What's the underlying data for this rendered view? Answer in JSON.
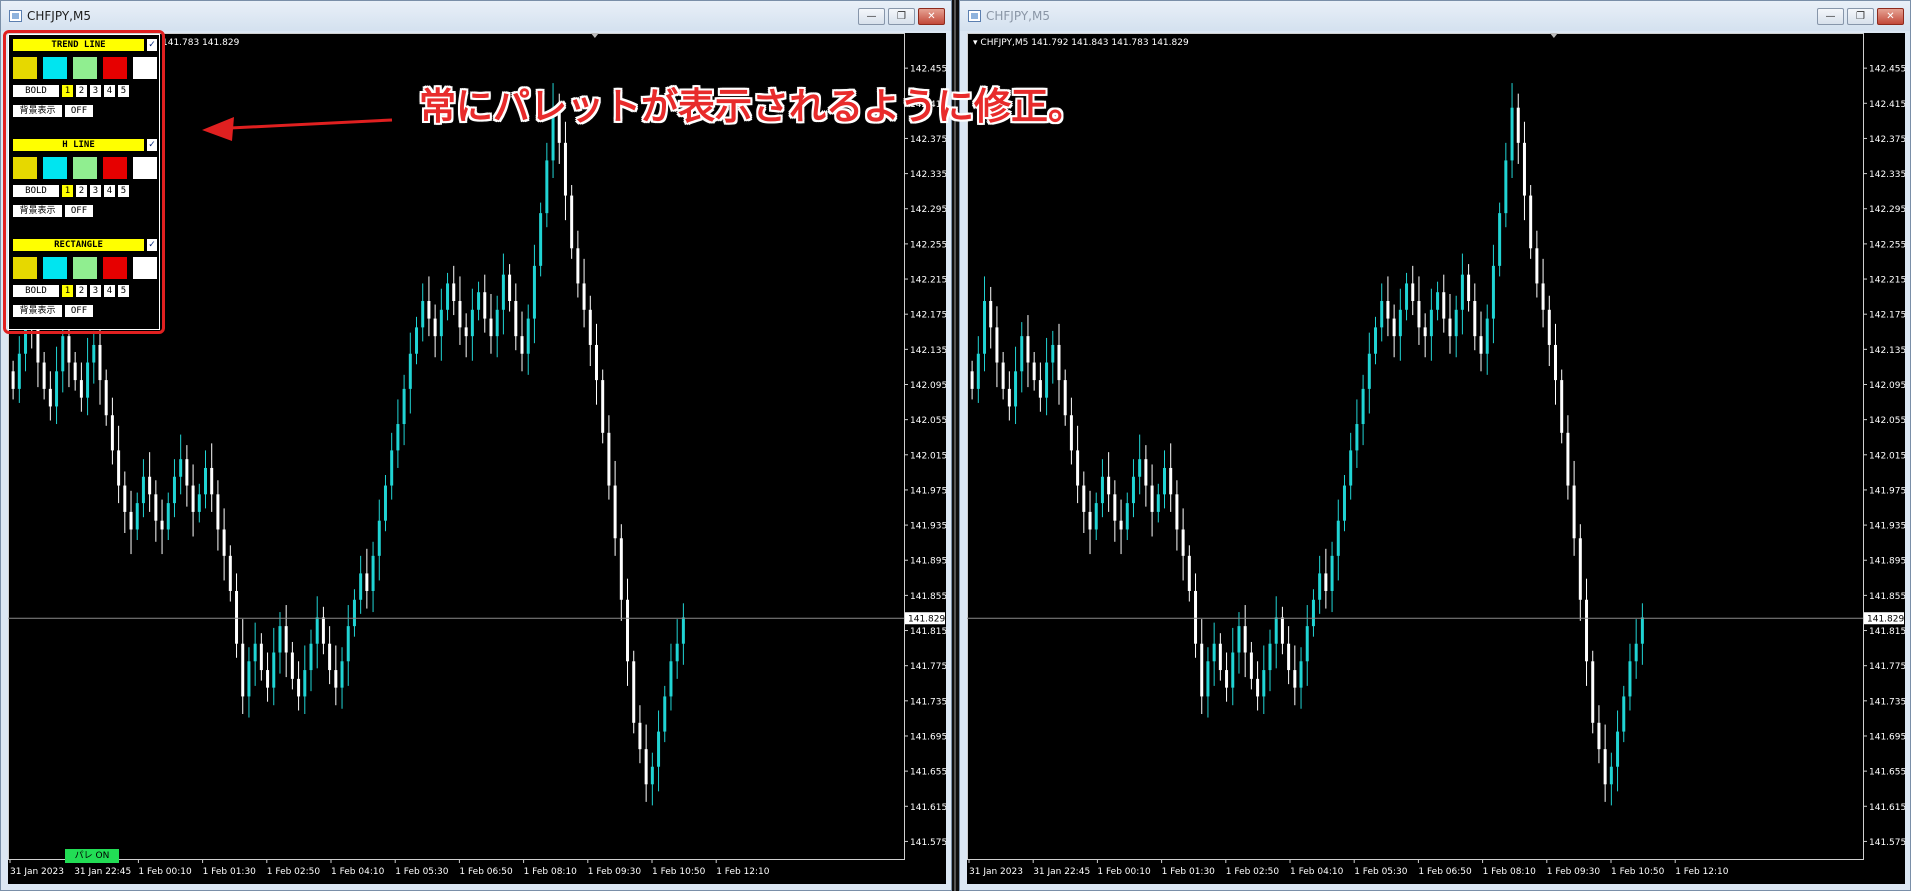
{
  "colors": {
    "bull": "#20d4d4",
    "bear": "#ffffff",
    "bg": "#000000",
    "highlight": "#e02020",
    "palette_head": "#ffff00",
    "pare_btn": "#22dd55"
  },
  "left_window": {
    "title": "CHFJPY,M5",
    "info": "141.783 141.829",
    "buttons": {
      "minimize": "—",
      "restore": "❐",
      "close": "✕"
    }
  },
  "right_window": {
    "title": "CHFJPY,M5",
    "info": "CHFJPY,M5  141.792 141.843 141.783 141.829",
    "buttons": {
      "minimize": "—",
      "restore": "❐",
      "close": "✕"
    }
  },
  "chart_data": {
    "type": "candlestick",
    "symbol": "CHFJPY",
    "timeframe": "M5",
    "ylim": [
      141.555,
      142.495
    ],
    "y_ticks": [
      "142.455",
      "142.415",
      "142.375",
      "142.335",
      "142.295",
      "142.255",
      "142.215",
      "142.175",
      "142.135",
      "142.095",
      "142.055",
      "142.015",
      "141.975",
      "141.935",
      "141.895",
      "141.855",
      "141.815",
      "141.775",
      "141.735",
      "141.695",
      "141.655",
      "141.615",
      "141.575"
    ],
    "current_price": "141.829",
    "x_ticks": [
      "31 Jan 2023",
      "31 Jan 22:45",
      "1 Feb 00:10",
      "1 Feb 01:30",
      "1 Feb 02:50",
      "1 Feb 04:10",
      "1 Feb 05:30",
      "1 Feb 06:50",
      "1 Feb 08:10",
      "1 Feb 09:30",
      "1 Feb 10:50",
      "1 Feb 12:10"
    ],
    "closes": [
      142.09,
      142.13,
      142.19,
      142.16,
      142.12,
      142.09,
      142.07,
      142.11,
      142.15,
      142.12,
      142.1,
      142.08,
      142.12,
      142.14,
      142.1,
      142.06,
      142.02,
      141.98,
      141.95,
      141.93,
      141.96,
      141.99,
      141.97,
      141.94,
      141.93,
      141.96,
      141.99,
      142.01,
      141.98,
      141.95,
      141.97,
      142.0,
      141.97,
      141.93,
      141.9,
      141.86,
      141.8,
      141.74,
      141.78,
      141.8,
      141.77,
      141.75,
      141.79,
      141.82,
      141.79,
      141.76,
      141.74,
      141.77,
      141.8,
      141.83,
      141.8,
      141.77,
      141.75,
      141.78,
      141.82,
      141.85,
      141.88,
      141.86,
      141.9,
      141.94,
      141.98,
      142.02,
      142.05,
      142.09,
      142.13,
      142.16,
      142.19,
      142.17,
      142.15,
      142.18,
      142.21,
      142.19,
      142.16,
      142.15,
      142.18,
      142.2,
      142.17,
      142.15,
      142.18,
      142.22,
      142.19,
      142.15,
      142.13,
      142.17,
      142.23,
      142.29,
      142.35,
      142.41,
      142.37,
      142.31,
      142.25,
      142.21,
      142.18,
      142.14,
      142.1,
      142.04,
      141.98,
      141.92,
      141.85,
      141.78,
      141.71,
      141.68,
      141.64,
      141.66,
      141.7,
      141.74,
      141.78,
      141.8,
      141.83
    ]
  },
  "palette": {
    "sections": [
      {
        "title": "TREND LINE",
        "check": "✓",
        "bold": "BOLD",
        "nums": [
          "1",
          "2",
          "3",
          "4",
          "5"
        ],
        "bg_label": "背景表示",
        "off": "OFF"
      },
      {
        "title": "H LINE",
        "check": "✓",
        "bold": "BOLD",
        "nums": [
          "1",
          "2",
          "3",
          "4",
          "5"
        ],
        "bg_label": "背景表示",
        "off": "OFF"
      },
      {
        "title": "RECTANGLE",
        "check": "✓",
        "bold": "BOLD",
        "nums": [
          "1",
          "2",
          "3",
          "4",
          "5"
        ],
        "bg_label": "背景表示",
        "off": "OFF"
      }
    ],
    "swatches": [
      "#e6d800",
      "#00e5f0",
      "#90ee90",
      "#e60000",
      "#ffffff"
    ]
  },
  "annotation": "常にパレットが表示されるように修正。",
  "pare_button": "パレ ON"
}
